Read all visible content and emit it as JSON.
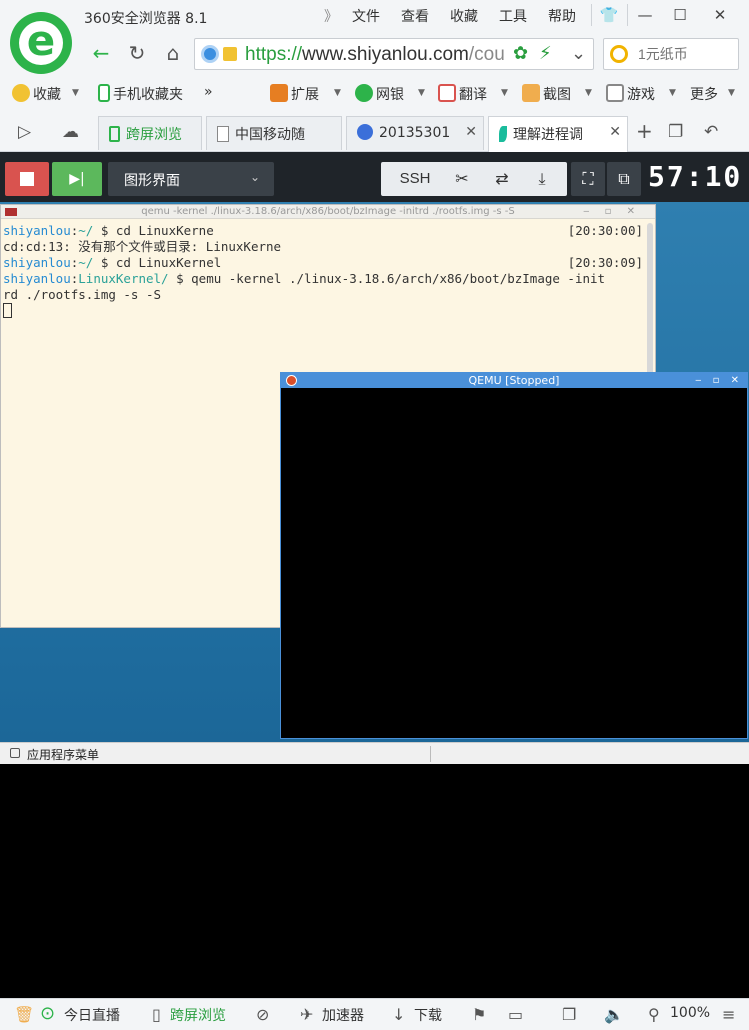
{
  "app": {
    "title": "360安全浏览器 8.1",
    "logo_letter": "e",
    "colors": {
      "brand": "#2db34a",
      "https": "#2a9e3f"
    }
  },
  "menu": {
    "separator": "》",
    "items": [
      "文件",
      "查看",
      "收藏",
      "工具",
      "帮助"
    ]
  },
  "window_controls": {
    "skin": "👕",
    "minimize": "—",
    "maximize": "☐",
    "close": "✕"
  },
  "nav": {
    "back": "←",
    "reload": "↻",
    "home": "⌂",
    "url_scheme": "https://",
    "url_host": "www.shiyanlou.com",
    "url_rest": "/cou",
    "flash": "⚡",
    "dropdown": "⌄",
    "search_placeholder": "1元纸币"
  },
  "bookmarks": {
    "favorites": "收藏",
    "mobile_favorites": "手机收藏夹",
    "more_arrow": "»",
    "extensions": "扩展",
    "banking": "网银",
    "translate": "翻译",
    "screenshot": "截图",
    "games": "游戏",
    "more": "更多",
    "caret": "▼"
  },
  "tabs": {
    "sidebar_toggle": "▷",
    "cloud": "☁",
    "items": [
      {
        "label": "跨屏浏览"
      },
      {
        "label": "中国移动随"
      },
      {
        "label": "20135301"
      },
      {
        "label": "理解进程调"
      }
    ],
    "close": "✕",
    "new_tab": "+",
    "restore": "↶"
  },
  "vm_toolbar": {
    "play_icon": "▶|",
    "mode": "图形界面",
    "mode_caret": "⌄",
    "ssh": "SSH",
    "cut_icon": "✂",
    "share_icon": "⇄",
    "download_icon": "⤓",
    "fullscreen_icon": "⛶",
    "popout_icon": "⧉",
    "timer": "57:10"
  },
  "terminal": {
    "title": "qemu -kernel ./linux-3.18.6/arch/x86/boot/bzImage -initrd ./rootfs.img -s -S",
    "title_buttons": "‒ ▫ ✕",
    "lines": [
      {
        "user": "shiyanlou",
        "colon": ":",
        "path": "~/",
        "cmd": " $ cd LinuxKerne",
        "time": "[20:30:00]"
      },
      {
        "output": "cd:cd:13: 没有那个文件或目录: LinuxKerne"
      },
      {
        "user": "shiyanlou",
        "colon": ":",
        "path": "~/",
        "cmd": " $ cd LinuxKernel",
        "time": "[20:30:09]"
      },
      {
        "user": "shiyanlou",
        "colon": ":",
        "path": "LinuxKernel/",
        "cmd": " $ qemu -kernel ./linux-3.18.6/arch/x86/boot/bzImage -init"
      },
      {
        "output": "rd ./rootfs.img -s -S"
      }
    ]
  },
  "qemu": {
    "title": "QEMU [Stopped]",
    "buttons": "‒ ▫ ✕"
  },
  "vm_taskbar": {
    "label": "应用程序菜单"
  },
  "statusbar": {
    "trash": "🗑",
    "live": "今日直播",
    "cross_screen": "跨屏浏览",
    "accelerator": "加速器",
    "download": "下载",
    "flag": "⚑",
    "window": "❐",
    "sound": "🔈",
    "zoom": "100%"
  }
}
